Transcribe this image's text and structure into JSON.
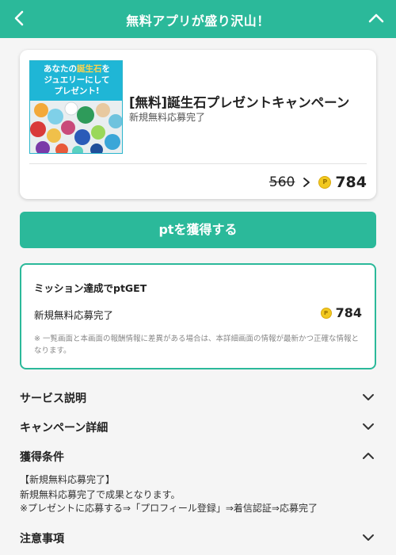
{
  "header": {
    "title": "無料アプリが盛り沢山！",
    "back_icon": "chevron-left-icon",
    "collapse_icon": "chevron-up-icon",
    "bg_color": "#2bb99a"
  },
  "campaign": {
    "thumbnail_text": {
      "line1_prefix": "あなたの",
      "line1_highlight": "誕生石",
      "line1_suffix": "を",
      "line2": "ジュエリーにして",
      "line3": "プレゼント!"
    },
    "title": "[無料]誕生石プレゼントキャンペーン",
    "subtitle": "新規無料応募完了",
    "old_points": "560",
    "new_points": "784",
    "coin_letter": "P"
  },
  "get_button": {
    "label": "ptを獲得する"
  },
  "mission": {
    "title": "ミッション達成でptGET",
    "item_label": "新規無料応募完了",
    "item_points": "784",
    "note": "※ 一覧画面と本画面の報酬情報に差異がある場合は、本詳細画面の情報が最新かつ正確な情報となります。"
  },
  "sections": {
    "service": "サービス説明",
    "campaign_detail": "キャンペーン詳細",
    "conditions": "獲得条件",
    "notes": "注意事項"
  },
  "conditions_body": {
    "line1": "【新規無料応募完了】",
    "line2": "新規無料応募完了で成果となります。",
    "line3": "※プレゼントに応募する⇒「プロフィール登録」⇒着信認証⇒応募完了"
  }
}
